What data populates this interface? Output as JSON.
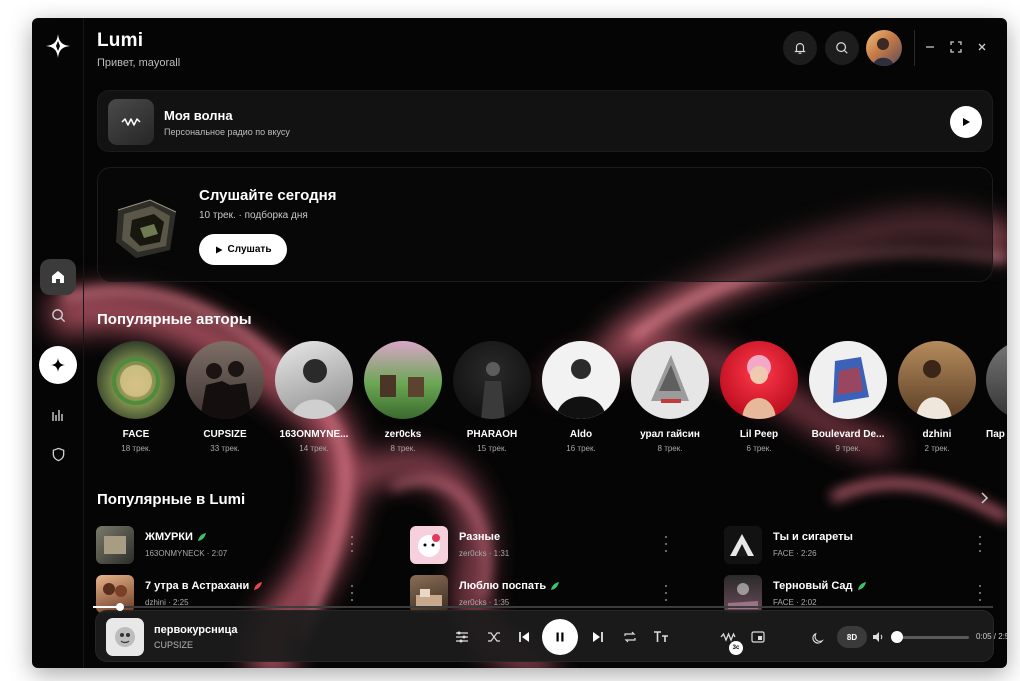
{
  "colors": {
    "accent": "#e46a7e",
    "background": "#050505",
    "leaf_green": "#3ec46d",
    "leaf_red": "#e2484f"
  },
  "header": {
    "title": "Lumi",
    "greeting": "Привет, mayorall"
  },
  "my_wave": {
    "title": "Моя волна",
    "subtitle": "Персональное радио по вкусу"
  },
  "today": {
    "title": "Слушайте сегодня",
    "subtitle": "10 трек. · подборка дня",
    "button": "Слушать"
  },
  "sections": {
    "popular_artists": "Популярные авторы",
    "popular_in_lumi": "Популярные в Lumi"
  },
  "artists": [
    {
      "name": "FACE",
      "count": "18 трек."
    },
    {
      "name": "CUPSIZE",
      "count": "33 трек."
    },
    {
      "name": "163ONMYNE...",
      "count": "14 трек."
    },
    {
      "name": "zer0cks",
      "count": "8 трек."
    },
    {
      "name": "PHARAOH",
      "count": "15 трек."
    },
    {
      "name": "Aldo",
      "count": "16 трек."
    },
    {
      "name": "урал гайсин",
      "count": "8 трек."
    },
    {
      "name": "Lil Peep",
      "count": "6 трек."
    },
    {
      "name": "Boulevard De...",
      "count": "9 трек."
    },
    {
      "name": "dzhini",
      "count": "2 трек."
    },
    {
      "name": "Пар",
      "count": ""
    }
  ],
  "tracks": [
    {
      "title": "ЖМУРКИ",
      "meta": "163ONMYNECK · 2:07",
      "leaf": "green"
    },
    {
      "title": "Разные",
      "meta": "zer0cks · 1:31",
      "leaf": ""
    },
    {
      "title": "Ты и сигареты",
      "meta": "FACE · 2:26",
      "leaf": ""
    },
    {
      "title": "7 утра в Астрахани",
      "meta": "dzhini · 2:25",
      "leaf": "red"
    },
    {
      "title": "Люблю поспать",
      "meta": "zer0cks · 1:35",
      "leaf": "green"
    },
    {
      "title": "Терновый Сад",
      "meta": "FACE · 2:02",
      "leaf": "green"
    }
  ],
  "player": {
    "title": "первокурсница",
    "artist": "CUPSIZE",
    "badge": "3c",
    "mode": "8D",
    "time": "0:05 / 2:56",
    "progress": 0.03,
    "volume": 0.0
  }
}
